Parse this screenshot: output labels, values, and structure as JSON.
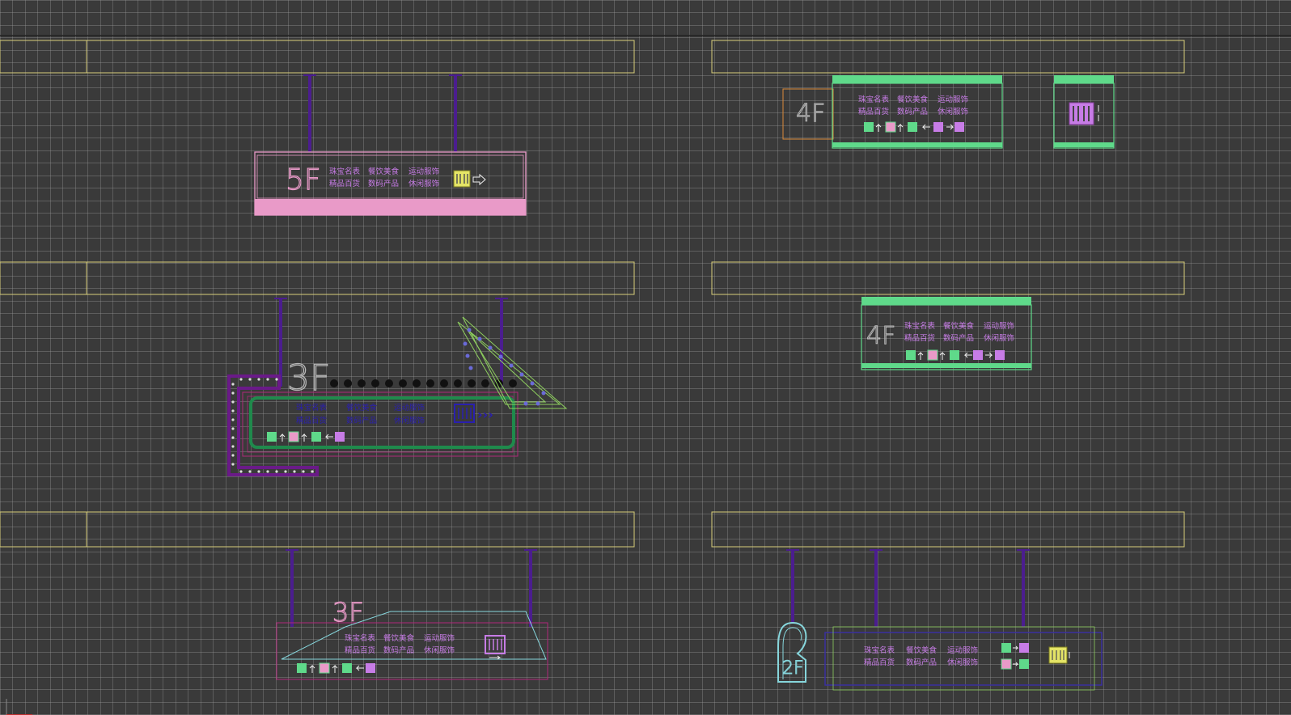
{
  "colors": {
    "background": "#3a3a3a",
    "grid": "#9a9a9a",
    "beam": "#d8cf7a",
    "rod": "#4b1d8f",
    "pink": "#e99ac8",
    "green": "#5fd98a",
    "darkgreen": "#1f8a4c",
    "violet": "#c77ce6",
    "navy": "#2a1fb0",
    "orange": "#d98a3a",
    "cyan": "#86d6dc",
    "yellow": "#e4e466",
    "magenta": "#b0287a"
  },
  "signs": {
    "s5f": {
      "floor": "5F",
      "row1": [
        "珠宝名表",
        "餐饮美食",
        "运动服饰"
      ],
      "row2": [
        "精品百货",
        "数码产品",
        "休闲服饰"
      ]
    },
    "s4f_top": {
      "floor": "4F",
      "row1": [
        "珠宝名表",
        "餐饮美食",
        "运动服饰"
      ],
      "row2": [
        "精品百货",
        "数码产品",
        "休闲服饰"
      ]
    },
    "s3f_arrow": {
      "floor": "3F",
      "row1": [
        "珠宝名表",
        "餐饮美食",
        "运动服饰"
      ],
      "row2": [
        "精品百货",
        "数码产品",
        "休闲服饰"
      ]
    },
    "s4f_mid": {
      "floor": "4F",
      "row1": [
        "珠宝名表",
        "餐饮美食",
        "运动服饰"
      ],
      "row2": [
        "精品百货",
        "数码产品",
        "休闲服饰"
      ]
    },
    "s3f_bottom": {
      "floor": "3F",
      "row1": [
        "珠宝名表",
        "餐饮美食",
        "运动服饰"
      ],
      "row2": [
        "精品百货",
        "数码产品",
        "休闲服饰"
      ]
    },
    "s2f": {
      "floor": "2F",
      "row1": [
        "珠宝名表",
        "餐饮美食",
        "运动服饰"
      ],
      "row2": [
        "精品百货",
        "数码产品",
        "休闲服饰"
      ]
    }
  },
  "icons": [
    "escalator-icon",
    "up-arrow-icon",
    "restaurant-icon",
    "left-arrow-icon",
    "shopping-icon",
    "restroom-icon",
    "right-arrow-icon",
    "chevrons-right-icon"
  ]
}
